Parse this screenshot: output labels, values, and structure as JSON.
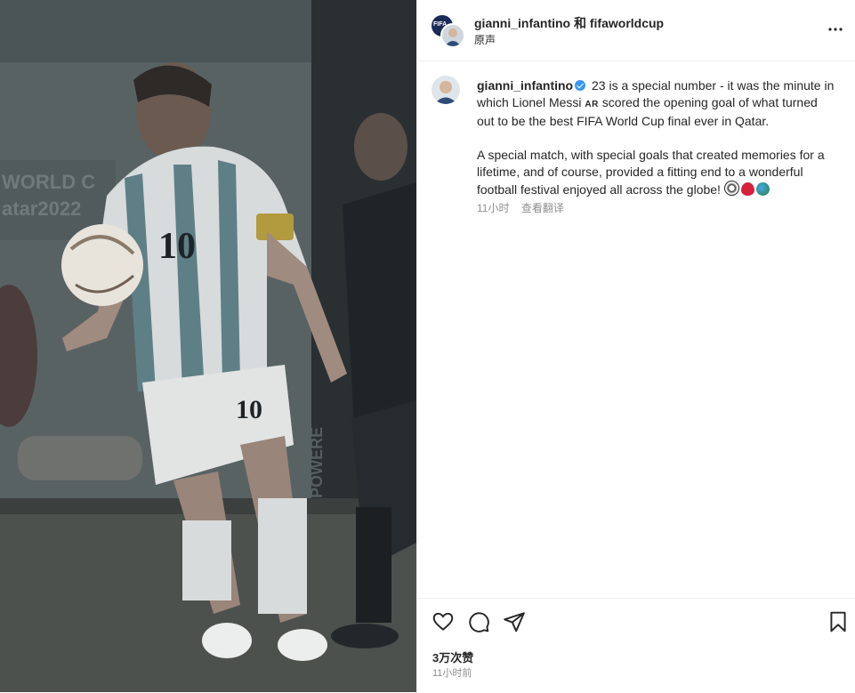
{
  "post": {
    "author": "gianni_infantino 和 fifaworldcup",
    "audio": "原声",
    "image_alt": "Lionel Messi (number 10) controls the ball during the World Cup final"
  },
  "photo": {
    "jersey_number": "10",
    "shorts_number": "10",
    "banner_text_1": "WORLD C",
    "banner_text_2": "atar2022",
    "board_text": "POWERE"
  },
  "caption": {
    "username": "gianni_infantino",
    "part1": "23 is a special number - it was the minute in which Lionel Messi ",
    "flag": "AR",
    "part2": " scored the opening goal of what turned out to be the best FIFA World Cup final ever in Qatar.",
    "paragraph2": "A special match, with special goals that created memories for a lifetime, and of course, provided a fitting end to a wonderful football festival enjoyed all across the globe! ",
    "time": "11小时",
    "translate": "查看翻译"
  },
  "stats": {
    "likes": "3万次赞",
    "posted": "11小时前"
  },
  "icons": {
    "like": "heart-icon",
    "comment": "comment-icon",
    "share": "share-icon",
    "save": "bookmark-icon",
    "more": "more-icon"
  },
  "colors": {
    "verified": "#3897f0",
    "text": "#262626",
    "muted": "#8e8e8e"
  }
}
